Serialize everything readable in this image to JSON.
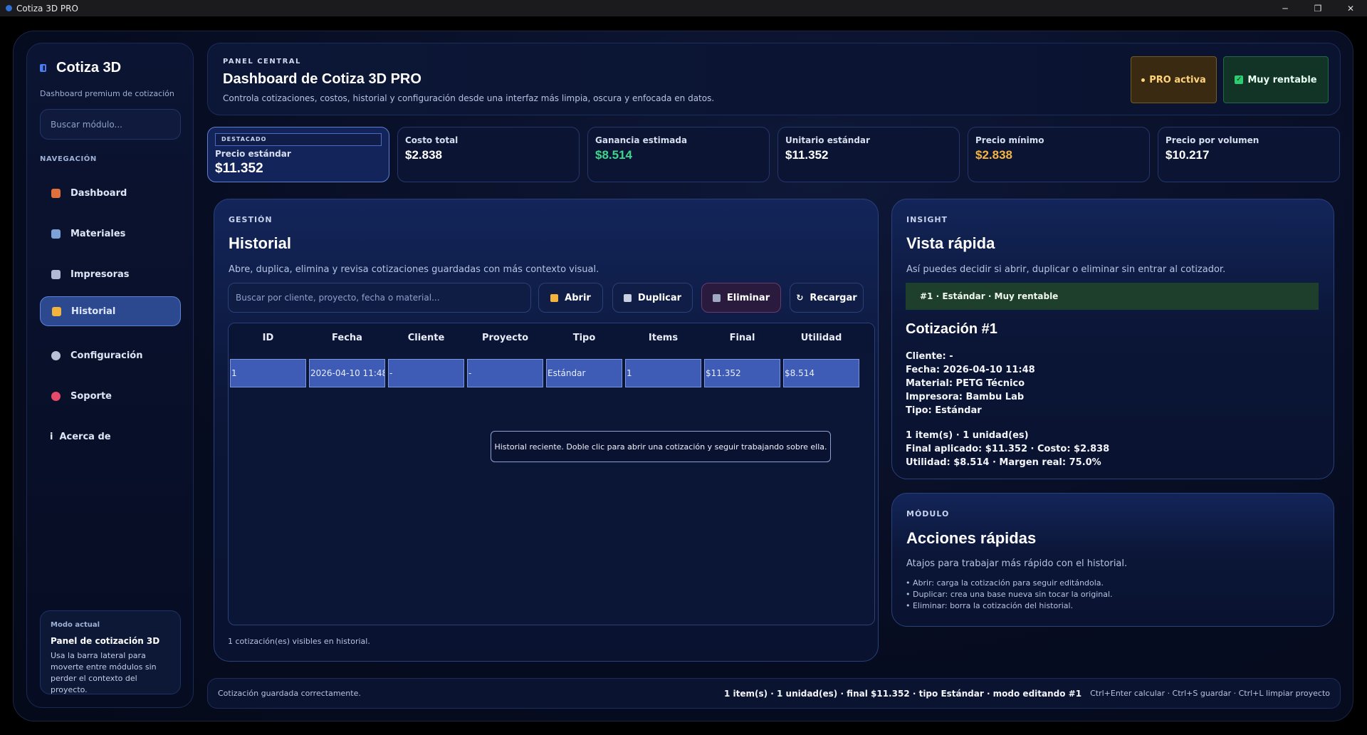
{
  "window": {
    "title": "Cotiza 3D PRO",
    "minimize": "─",
    "restore": "❐",
    "close": "✕"
  },
  "sidebar": {
    "brand": "Cotiza 3D",
    "subtitle": "Dashboard premium de cotización",
    "search_placeholder": "Buscar módulo...",
    "nav_heading": "NAVEGACIÓN",
    "items": [
      {
        "label": "Dashboard",
        "icon": "house-icon",
        "color": "#e0703c"
      },
      {
        "label": "Materiales",
        "icon": "spool-icon",
        "color": "#7ba1d8"
      },
      {
        "label": "Impresoras",
        "icon": "printer-icon",
        "color": "#b0b8d4"
      },
      {
        "label": "Historial",
        "icon": "folder-icon",
        "color": "#f2b43c",
        "active": true
      },
      {
        "label": "Configuración",
        "icon": "gear-icon",
        "color": "#b9c1d6"
      },
      {
        "label": "Soporte",
        "icon": "lifebuoy-icon",
        "color": "#e64a6a"
      },
      {
        "label": "Acerca de",
        "icon": "info-icon",
        "color": "#e6ebf7"
      }
    ],
    "mode_card": {
      "label": "Modo actual",
      "title": "Panel de cotización 3D",
      "desc": "Usa la barra lateral para moverte entre módulos sin perder el contexto del proyecto."
    }
  },
  "header": {
    "eyebrow": "PANEL CENTRAL",
    "title": "Dashboard de Cotiza 3D PRO",
    "subtitle": "Controla cotizaciones, costos, historial y configuración desde una interfaz más limpia, oscura y enfocada en datos.",
    "badge_pro": "PRO activa",
    "badge_rent": "Muy rentable"
  },
  "stats": [
    {
      "tag": "DESTACADO",
      "label": "Precio estándar",
      "value": "$11.352"
    },
    {
      "label": "Costo total",
      "value": "$2.838"
    },
    {
      "label": "Ganancia estimada",
      "value": "$8.514"
    },
    {
      "label": "Unitario estándar",
      "value": "$11.352"
    },
    {
      "label": "Precio mínimo",
      "value": "$2.838"
    },
    {
      "label": "Precio por volumen",
      "value": "$10.217"
    }
  ],
  "historial": {
    "eyebrow": "GESTIÓN",
    "title": "Historial",
    "desc": "Abre, duplica, elimina y revisa cotizaciones guardadas con más contexto visual.",
    "search_placeholder": "Buscar por cliente, proyecto, fecha o material...",
    "buttons": {
      "open": "Abrir",
      "duplicate": "Duplicar",
      "delete": "Eliminar",
      "reload": "Recargar"
    },
    "columns": [
      "ID",
      "Fecha",
      "Cliente",
      "Proyecto",
      "Tipo",
      "Items",
      "Final",
      "Utilidad"
    ],
    "rows": [
      [
        "1",
        "2026-04-10 11:48",
        "-",
        "-",
        "Estándar",
        "1",
        "$11.352",
        "$8.514"
      ]
    ],
    "tooltip": "Historial reciente. Doble clic para abrir una cotización y seguir trabajando sobre ella.",
    "footer": "1 cotización(es) visibles en historial."
  },
  "insight": {
    "eyebrow": "INSIGHT",
    "title": "Vista rápida",
    "desc": "Así puedes decidir si abrir, duplicar o eliminar sin entrar al cotizador.",
    "chip": "#1 · Estándar · Muy rentable",
    "quote_title": "Cotización #1",
    "details": [
      "Cliente: -",
      "Fecha: 2026-04-10 11:48",
      "Material: PETG Técnico",
      "Impresora: Bambu Lab",
      "Tipo: Estándar"
    ],
    "summary": [
      "1 item(s) · 1 unidad(es)",
      "Final aplicado: $11.352 · Costo: $2.838",
      "Utilidad: $8.514 · Margen real: 75.0%"
    ]
  },
  "modulo": {
    "eyebrow": "MÓDULO",
    "title": "Acciones rápidas",
    "desc": "Atajos para trabajar más rápido con el historial.",
    "items": [
      "• Abrir: carga la cotización para seguir editándola.",
      "• Duplicar: crea una base nueva sin tocar la original.",
      "• Eliminar: borra la cotización del historial."
    ]
  },
  "statusbar": {
    "left": "Cotización guardada correctamente.",
    "summary": "1 item(s) · 1 unidad(es) · final $11.352 · tipo Estándar · modo editando #1",
    "shortcuts": "Ctrl+Enter calcular · Ctrl+S guardar · Ctrl+L limpiar proyecto"
  }
}
